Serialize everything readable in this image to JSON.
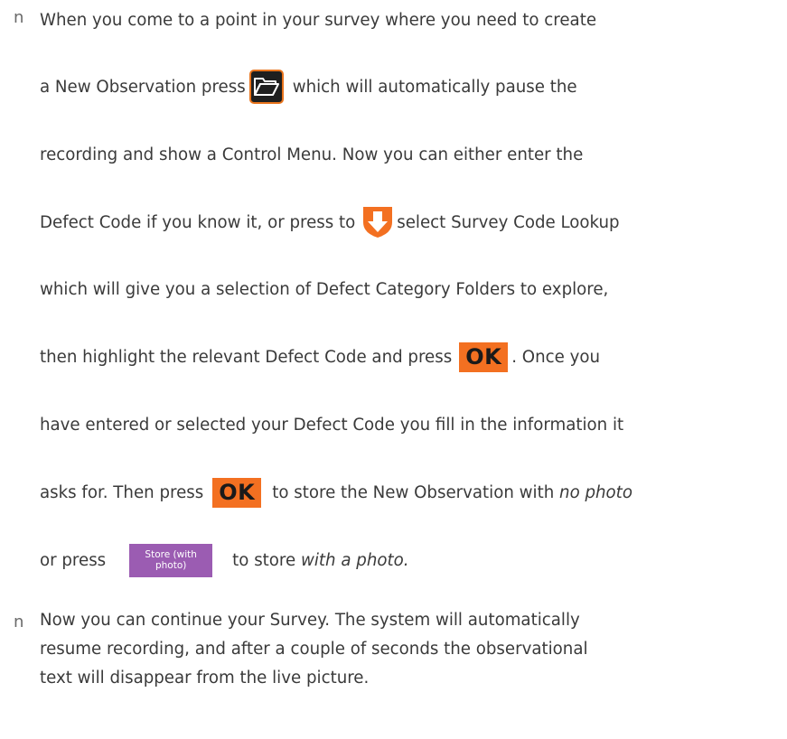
{
  "bullet_marker": "n",
  "paragraph1": {
    "line1": "When you come to a point in your survey where you need to create",
    "line2_a": "a New Observation press",
    "line2_b": "which will automatically pause the",
    "line3": "recording and show a Control Menu. Now you can either enter the",
    "line4_a": "Defect Code if you know it, or press to",
    "line4_b": "select Survey Code Lookup",
    "line5": "which will give you a selection of Defect Category Folders to explore,",
    "line6_a": "then highlight the relevant Defect Code and press",
    "line6_b": ". Once you",
    "line7": "have entered or selected your Defect Code you fill in the information it",
    "line8_a": "asks for. Then press",
    "line8_b": "to store the New Observation with",
    "line8_c": "no photo",
    "line9_a": "or press",
    "line9_b": "to store",
    "line9_c": "with a photo."
  },
  "ok_label": "OK",
  "store_button": {
    "line1": "Store (with",
    "line2": "photo)"
  },
  "paragraph2": {
    "line1": "Now you can continue your Survey. The system will automatically",
    "line2": "resume recording, and after a couple of seconds the observational",
    "line3": "text will disappear from the live picture."
  },
  "colors": {
    "ok_orange": "#f37021",
    "store_purple": "#9b5cb2",
    "folder_border": "#e8731c"
  }
}
